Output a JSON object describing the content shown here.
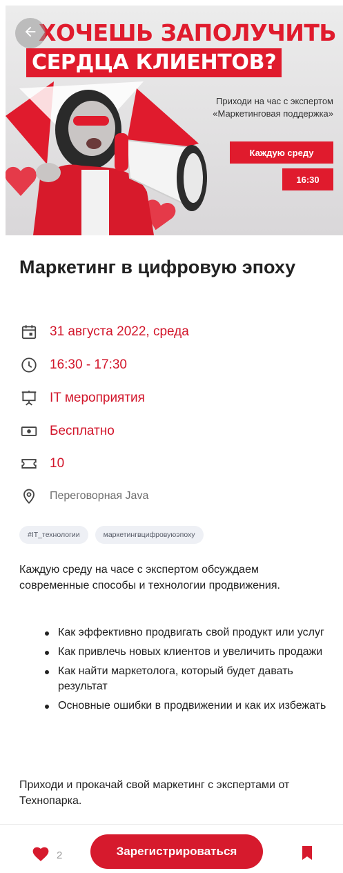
{
  "banner": {
    "headline_line1": "ХОЧЕШЬ ЗАПОЛУЧИТЬ",
    "headline_line2": "СЕРДЦА КЛИЕНТОВ?",
    "promo_line1": "Приходи на час с экспертом",
    "promo_line2": "«Маркетинговая поддержка»",
    "day_chip": "Каждую среду",
    "time_chip": "16:30"
  },
  "event": {
    "title": "Маркетинг в цифровую эпоху",
    "date": "31 августа 2022, среда",
    "time": "16:30 - 17:30",
    "category": "IT мероприятия",
    "price": "Бесплатно",
    "tickets": "10",
    "location": "Переговорная Java"
  },
  "tags": [
    "#IT_технологии",
    "маркетингвцифровуюэпоху"
  ],
  "description": {
    "intro": "Каждую среду на часе с экспертом обсуждаем современные способы и технологии продвижения.",
    "bullets": [
      "Как эффективно продвигать свой продукт или услуг",
      "Как привлечь новых клиентов и увеличить продажи",
      "Как найти маркетолога, который будет давать результат",
      "Основные ошибки в продвижении и как их избежать"
    ],
    "outro": "Приходи и прокачай свой маркетинг с экспертами от Технопарка."
  },
  "footer": {
    "likes_count": "2",
    "register_label": "Зарегистрироваться"
  },
  "colors": {
    "accent": "#d61a2d",
    "tag_bg": "#eef0f5",
    "muted": "#6e6e6e"
  },
  "icons": {
    "back": "arrow-left-icon",
    "date": "calendar-icon",
    "time": "clock-icon",
    "category": "presentation-board-icon",
    "price": "banknote-icon",
    "tickets": "ticket-icon",
    "location": "map-pin-icon",
    "like": "heart-icon",
    "bookmark": "bookmark-icon"
  }
}
